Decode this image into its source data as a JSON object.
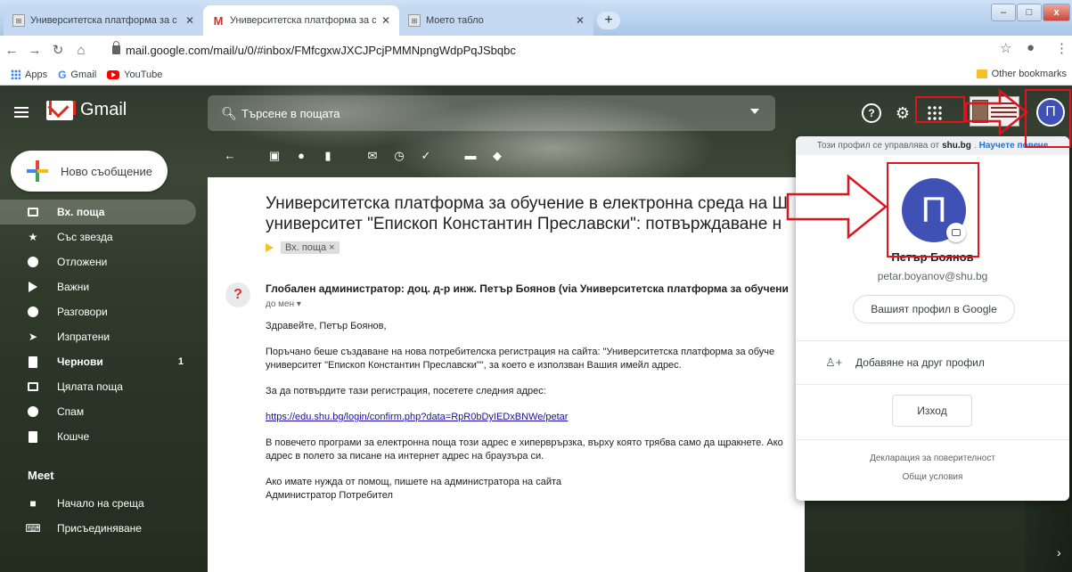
{
  "browser": {
    "tabs": [
      {
        "title": "Университетска платформа за с",
        "active": false
      },
      {
        "title": "Университетска платформа за с",
        "active": true
      },
      {
        "title": "Моето табло",
        "active": false
      }
    ],
    "new_tab": "+",
    "window_controls": {
      "min": "–",
      "max": "□",
      "close": "x"
    },
    "url": "mail.google.com/mail/u/0/#inbox/FMfcgxwJXCJPcjPMMNpngWdpPqJSbqbc",
    "bookmarks": [
      "Apps",
      "Gmail",
      "YouTube"
    ],
    "other_bookmarks": "Other bookmarks"
  },
  "gmail": {
    "logo_text": "Gmail",
    "search_placeholder": "Търсене в пощата",
    "compose_label": "Ново съобщение",
    "nav": [
      {
        "label": "Вх. поща",
        "icon": "inbox-icon",
        "active": true
      },
      {
        "label": "Със звезда",
        "icon": "star-icon"
      },
      {
        "label": "Отложени",
        "icon": "clock-icon"
      },
      {
        "label": "Важни",
        "icon": "important-icon"
      },
      {
        "label": "Разговори",
        "icon": "chat-icon"
      },
      {
        "label": "Изпратени",
        "icon": "send-icon"
      },
      {
        "label": "Чернови",
        "icon": "draft-icon",
        "count": "1",
        "bold": true
      },
      {
        "label": "Цялата поща",
        "icon": "mail-icon"
      },
      {
        "label": "Спам",
        "icon": "spam-icon"
      },
      {
        "label": "Кошче",
        "icon": "trash-icon"
      }
    ],
    "meet_header": "Meet",
    "meet_items": [
      {
        "label": "Начало на среща",
        "icon": "video-icon"
      },
      {
        "label": "Присъединяване",
        "icon": "keyboard-icon"
      }
    ],
    "message": {
      "subject_line1": "Университетска платформа за обучение в електронна среда на Ш",
      "subject_line2": "университет \"Епископ Константин Преславски\": потвърждаване н",
      "label_chip": "Вх. поща",
      "from": "Глобален администратор: доц. д-р инж. Петър Боянов (via Университетска платформа за обучени",
      "to": "до мен ▾",
      "greeting": "Здравейте, Петър Боянов,",
      "para1_line1": "Поръчано беше създаване на нова потребителска регистрация на сайта: \"Университетска платформа за обуче",
      "para1_line2": "университет \"Епископ Константин Преславски\"\", за което е използван Вашия имейл адрес.",
      "para2": "За да потвърдите тази регистрация, посетете следния адрес:",
      "link": "https://edu.shu.bg/login/confirm.php?data=RpR0bDyIEDxBNWe/petar",
      "para3_line1": "В повечето програми за електронна поща този адрес е хиперврързка, върху която трябва само да щракнете. Ако",
      "para3_line2": "адрес в полето за писане на интернет адрес на браузъра си.",
      "para4_line1": "Ако имате нужда от помощ, пишете на администратора на сайта",
      "para4_line2": "Администратор Потребител"
    },
    "avatar_letter": "П"
  },
  "account_popup": {
    "managed_prefix": "Този профил се управлява от",
    "managed_domain": "shu.bg",
    "managed_link": "Научете повече",
    "avatar_letter": "П",
    "name": "Петър Боянов",
    "email": "petar.boyanov@shu.bg",
    "profile_button": "Вашият профил в Google",
    "add_account": "Добавяне на друг профил",
    "signout": "Изход",
    "privacy": "Декларация за поверителност",
    "terms": "Общи условия"
  },
  "colors": {
    "annotation_red": "#e0141e",
    "avatar": "#3f51b5",
    "link": "#1a73e8"
  }
}
